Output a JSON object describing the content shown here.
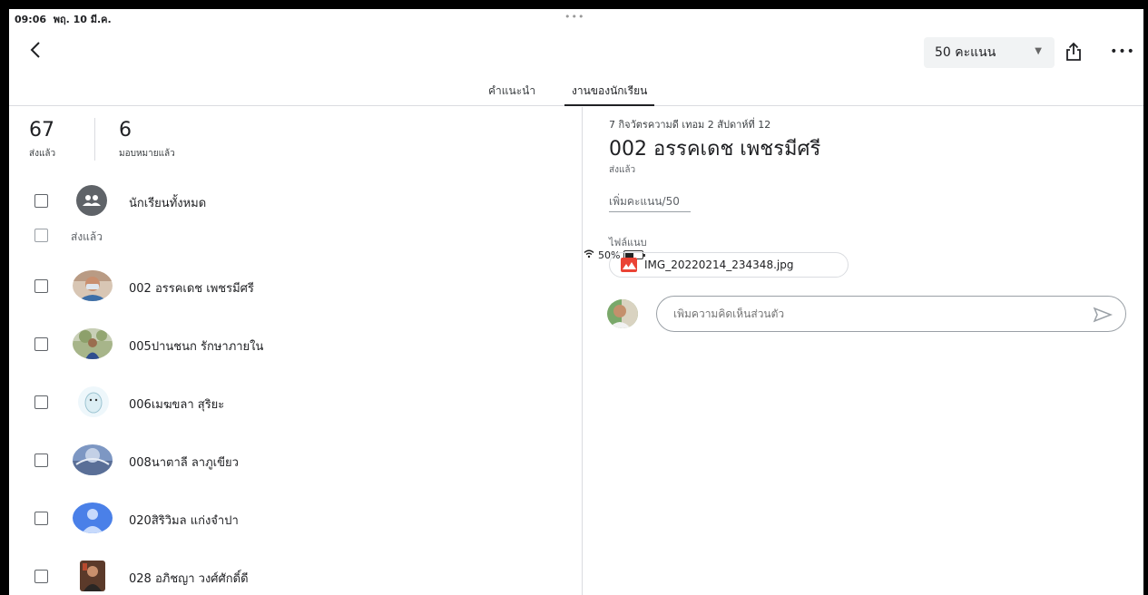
{
  "status_bar": {
    "time": "09:06",
    "date": "พฤ. 10 มี.ค.",
    "dots": "•••",
    "battery": "50%",
    "battery_level": 0.5
  },
  "toolbar": {
    "points_label": "50 คะแนน"
  },
  "tabs": [
    {
      "label": "คำแนะนำ"
    },
    {
      "label": "งานของนักเรียน"
    }
  ],
  "stats": {
    "turned_in_count": "67",
    "turned_in_label": "ส่งแล้ว",
    "assigned_count": "6",
    "assigned_label": "มอบหมายแล้ว"
  },
  "all_students_label": "นักเรียนทั้งหมด",
  "section_turned_in": "ส่งแล้ว",
  "students": [
    {
      "name": "002 อรรคเดช เพชรมีศรี"
    },
    {
      "name": "005ปานชนก รักษาภายใน"
    },
    {
      "name": "006เมฆขลา สุริยะ"
    },
    {
      "name": "008นาตาลี ลาภูเขียว"
    },
    {
      "name": "020สิริวิมล แก่งจำปา"
    },
    {
      "name": "028 อภิชญา วงศ์ศักดิ์ดี"
    }
  ],
  "detail": {
    "assignment_title": "7 กิจวัตรความดี เทอม 2 สัปดาห์ที่ 12",
    "student_name": "002 อรรคเดช เพชรมีศรี",
    "status": "ส่งแล้ว",
    "add_points": "เพิ่มคะแนน/50",
    "attachments_label": "ไฟล์แนบ",
    "attachment_file": "IMG_20220214_234348.jpg",
    "comment_placeholder": "เพิ่มความคิดเห็นส่วนตัว"
  }
}
